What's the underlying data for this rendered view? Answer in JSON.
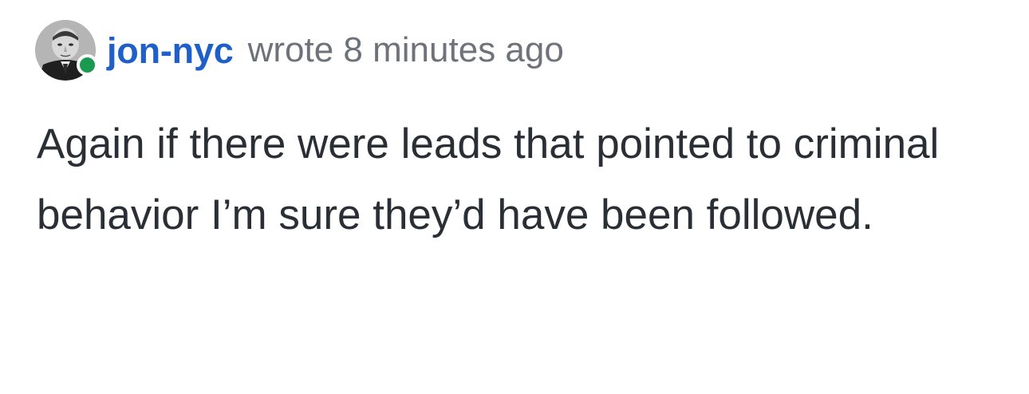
{
  "comment": {
    "author": "jon-nyc",
    "meta": "wrote 8 minutes ago",
    "body": "Again if there were leads that pointed to criminal behavior I’m sure they’d have been followed.",
    "avatar_icon": "user-avatar-portrait",
    "presence_status": "online",
    "colors": {
      "author": "#1f5fc9",
      "meta": "#6e7279",
      "body": "#2a2e35",
      "presence": "#1a9a50"
    }
  }
}
